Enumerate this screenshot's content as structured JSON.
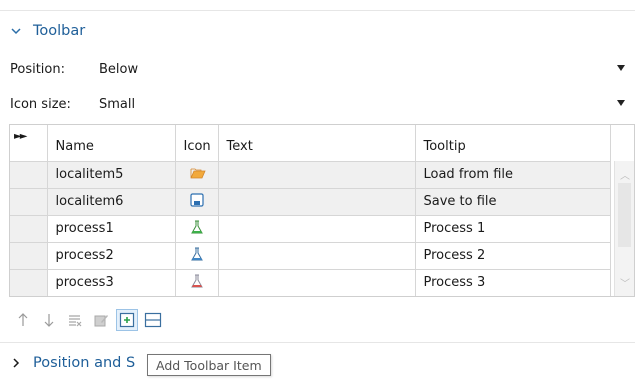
{
  "toolbar_section": {
    "title": "Toolbar"
  },
  "position": {
    "label": "Position:",
    "value": "Below"
  },
  "icon_size": {
    "label": "Icon size:",
    "value": "Small"
  },
  "table": {
    "columns": [
      "Name",
      "Icon",
      "Text",
      "Tooltip"
    ],
    "rows": [
      {
        "name": "localitem5",
        "icon": "folder-open-icon",
        "text": "",
        "tooltip": "Load from file"
      },
      {
        "name": "localitem6",
        "icon": "save-icon",
        "text": "",
        "tooltip": "Save to file"
      },
      {
        "name": "process1",
        "icon": "flask-green-icon",
        "text": "",
        "tooltip": "Process 1"
      },
      {
        "name": "process2",
        "icon": "flask-blue-icon",
        "text": "",
        "tooltip": "Process 2"
      },
      {
        "name": "process3",
        "icon": "flask-red-icon",
        "text": "",
        "tooltip": "Process 3"
      }
    ]
  },
  "toolbar_buttons": [
    "move-up-icon",
    "move-down-icon",
    "delete-icon",
    "edit-icon",
    "add-toolbar-item-icon",
    "add-separator-icon"
  ],
  "position_section": {
    "title": "Position and S"
  },
  "tooltip": {
    "text": "Add Toolbar Item"
  },
  "colors": {
    "accent": "#1f5f99",
    "row_gray": "#f0f0f0",
    "active_button": "#e4f0fb"
  }
}
